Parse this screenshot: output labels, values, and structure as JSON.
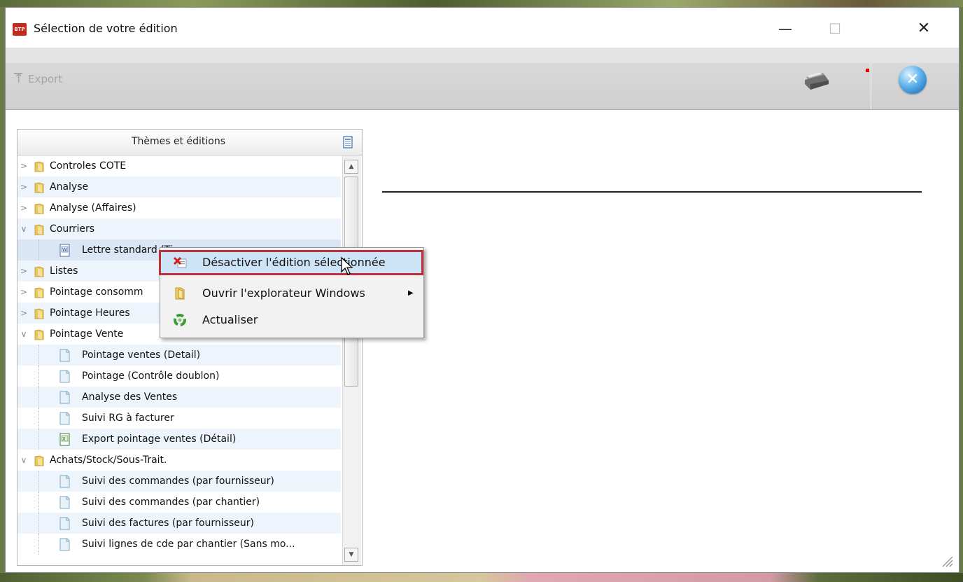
{
  "window": {
    "title": "Sélection de votre édition",
    "app_icon_text": "BTP",
    "controls": {
      "minimize": "—",
      "maximize": "☐",
      "close": "✕"
    }
  },
  "toolbar": {
    "export_label": "Export",
    "icons": [
      "export-icon",
      "printer-icon",
      "close-circle-icon"
    ]
  },
  "panel": {
    "header": "Thèmes et éditions",
    "tree": [
      {
        "label": "Controles COTE",
        "type": "folder",
        "expanded": false,
        "depth": 0
      },
      {
        "label": "Analyse",
        "type": "folder",
        "expanded": false,
        "depth": 0
      },
      {
        "label": "Analyse (Affaires)",
        "type": "folder",
        "expanded": false,
        "depth": 0
      },
      {
        "label": "Courriers",
        "type": "folder",
        "expanded": true,
        "depth": 0
      },
      {
        "label": "Lettre standard (Ti",
        "type": "word-doc",
        "depth": 1,
        "selected": true
      },
      {
        "label": "Listes",
        "type": "folder",
        "expanded": false,
        "depth": 0
      },
      {
        "label": "Pointage consomm",
        "type": "folder",
        "expanded": false,
        "depth": 0
      },
      {
        "label": "Pointage Heures",
        "type": "folder",
        "expanded": false,
        "depth": 0
      },
      {
        "label": "Pointage Vente",
        "type": "folder",
        "expanded": true,
        "depth": 0
      },
      {
        "label": "Pointage ventes (Detail)",
        "type": "doc",
        "depth": 1
      },
      {
        "label": "Pointage (Contrôle doublon)",
        "type": "doc",
        "depth": 1
      },
      {
        "label": "Analyse des Ventes",
        "type": "doc",
        "depth": 1
      },
      {
        "label": "Suivi RG à facturer",
        "type": "doc",
        "depth": 1
      },
      {
        "label": "Export pointage ventes (Détail)",
        "type": "excel-doc",
        "depth": 1
      },
      {
        "label": "Achats/Stock/Sous-Trait.",
        "type": "folder",
        "expanded": true,
        "depth": 0
      },
      {
        "label": "Suivi des commandes (par fournisseur)",
        "type": "doc",
        "depth": 1
      },
      {
        "label": "Suivi des commandes (par chantier)",
        "type": "doc",
        "depth": 1
      },
      {
        "label": "Suivi des factures (par fournisseur)",
        "type": "doc",
        "depth": 1
      },
      {
        "label": "Suivi lignes de cde par chantier (Sans mo...",
        "type": "doc",
        "depth": 1
      }
    ]
  },
  "context_menu": {
    "items": [
      {
        "label": "Désactiver l'édition sélectionnée",
        "icon": "deactivate-icon",
        "highlighted": true
      },
      {
        "label": "Ouvrir l'explorateur Windows",
        "icon": "folder-icon",
        "submenu": true
      },
      {
        "label": "Actualiser",
        "icon": "refresh-icon"
      }
    ]
  },
  "colors": {
    "highlight_border": "#c0303a",
    "selection_bg": "#cde3f6",
    "alt_row_bg": "#eef4fb",
    "folder_yellow": "#e9c85a"
  }
}
